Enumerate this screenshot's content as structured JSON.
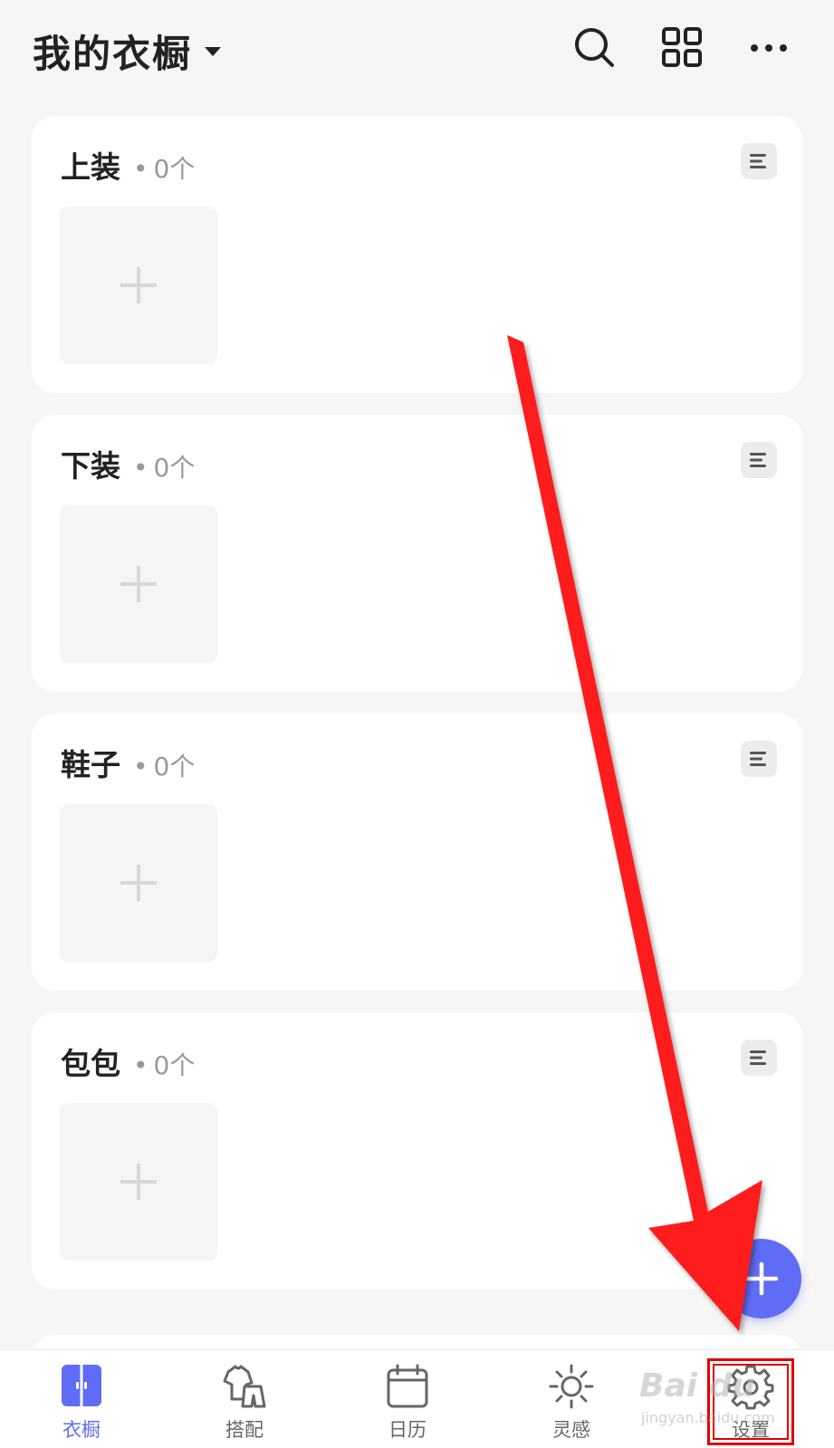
{
  "header": {
    "title": "我的衣橱",
    "icons": [
      "search-icon",
      "grid-icon",
      "more-icon"
    ]
  },
  "categories": [
    {
      "name": "上装",
      "dot": "•",
      "count": "0个"
    },
    {
      "name": "下装",
      "dot": "•",
      "count": "0个"
    },
    {
      "name": "鞋子",
      "dot": "•",
      "count": "0个"
    },
    {
      "name": "包包",
      "dot": "•",
      "count": "0个"
    }
  ],
  "fab": {
    "icon": "plus-icon"
  },
  "tabbar": {
    "items": [
      {
        "label": "衣橱",
        "icon": "wardrobe-icon",
        "active": true
      },
      {
        "label": "搭配",
        "icon": "outfit-icon",
        "active": false
      },
      {
        "label": "日历",
        "icon": "calendar-icon",
        "active": false
      },
      {
        "label": "灵感",
        "icon": "inspiration-sun-icon",
        "active": false
      },
      {
        "label": "设置",
        "icon": "gear-icon",
        "active": false
      }
    ]
  },
  "watermark": {
    "brand": "Bai du",
    "sub": "jingyan.baidu.com"
  },
  "colors": {
    "accent": "#5f6cf5",
    "annotation": "#e00000",
    "background": "#f6f6f6"
  }
}
